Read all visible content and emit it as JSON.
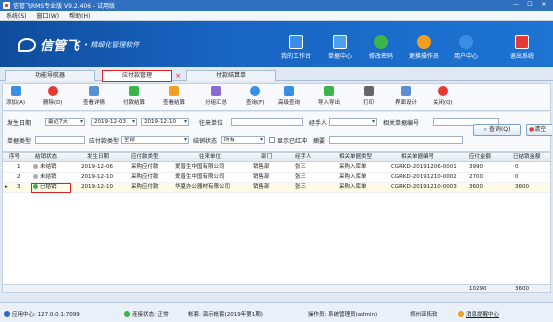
{
  "window": {
    "title": "信管飞RMS专业版 V9.2.406 - 试用版",
    "controls": [
      "—",
      "☐",
      "✕"
    ]
  },
  "menu": [
    "系统(S)",
    "窗口(W)",
    "帮助(H)"
  ],
  "banner": {
    "brand": "信管飞",
    "slogan": "• 精细化管理软件",
    "nav": [
      {
        "label": "我的工作台",
        "icon": "monitor-icon",
        "color": "#3a8ee6"
      },
      {
        "label": "单据中心",
        "icon": "documents-icon",
        "color": "#4aa3e8"
      },
      {
        "label": "修改密码",
        "icon": "key-icon",
        "color": "#3bb54a"
      },
      {
        "label": "更换操作员",
        "icon": "switch-user-icon",
        "color": "#f0a020"
      },
      {
        "label": "用户中心",
        "icon": "user-icon",
        "color": "#3a8ee6"
      },
      {
        "label": "退出系统",
        "icon": "power-icon",
        "color": "#e53935"
      }
    ]
  },
  "tabs": [
    {
      "label": "功能导航器",
      "active": false
    },
    {
      "label": "应付款管理",
      "active": true,
      "close": "×"
    },
    {
      "label": "付款结算单",
      "active": false
    }
  ],
  "toolbar": [
    {
      "label": "添加(A)",
      "icon": "add-icon",
      "color": "#3a8ee6"
    },
    {
      "label": "删除(D)",
      "icon": "delete-icon",
      "color": "#e53935"
    },
    {
      "label": "查看详情",
      "icon": "detail-icon",
      "color": "#5b8fd0"
    },
    {
      "label": "付款结算",
      "icon": "settle-icon",
      "color": "#3bb54a"
    },
    {
      "label": "查看结算",
      "icon": "view-settle-icon",
      "color": "#f0a020"
    },
    {
      "label": "分组汇总",
      "icon": "group-summary-icon",
      "color": "#8a6ad0"
    },
    {
      "label": "查询(F)",
      "icon": "query-icon",
      "color": "#3a8ee6"
    },
    {
      "label": "高级查询",
      "icon": "advanced-query-icon",
      "color": "#3a8ee6"
    },
    {
      "label": "导入导出",
      "icon": "import-export-icon",
      "color": "#3bb54a"
    },
    {
      "label": "打印",
      "icon": "print-icon",
      "color": "#666666"
    },
    {
      "label": "界面设计",
      "icon": "layout-design-icon",
      "color": "#5b8fd0"
    },
    {
      "label": "关闭(Q)",
      "icon": "close-icon",
      "color": "#e53935"
    }
  ],
  "filters": {
    "date_label": "发生日期",
    "date_range": "最近7天",
    "date_from": "2019-12-03",
    "date_to": "2019-12-10",
    "counterpart_label": "往来单位",
    "counterpart_value": "",
    "handler_label": "经手人",
    "handler_value": "",
    "related_doc_label": "相关单据编号",
    "related_doc_value": "",
    "doc_type_label": "单据类型",
    "doc_type_value": "",
    "ap_type_label": "应付款类型",
    "ap_type_value": "全部",
    "settle_status_label": "结销状态",
    "settle_status_value": "所有",
    "show_red_label": "显示已红冲",
    "remark_label": "摘要",
    "remark_value": "",
    "query_button": "查询(Q)",
    "reset_button": "清空"
  },
  "grid": {
    "columns": [
      "序号",
      "结销状态",
      "发生日期",
      "应付款类型",
      "往来单位",
      "部门",
      "经手人",
      "相关单据类型",
      "相关单据编号",
      "应付金额",
      "已结销金额"
    ],
    "rows": [
      {
        "no": "1",
        "status": "未结销",
        "status_color": "#aaaaaa",
        "date": "2019-12-06",
        "type": "采购应付款",
        "unit": "爱普生中国有限公司",
        "dept": "销售部",
        "handler": "张三",
        "doc_type": "采购入库单",
        "doc_no": "CGRKD-20191206-0001",
        "amount": "3990",
        "settled": "0"
      },
      {
        "no": "2",
        "status": "未结销",
        "status_color": "#aaaaaa",
        "date": "2019-12-10",
        "type": "采购应付款",
        "unit": "爱普生中国有限公司",
        "dept": "销售部",
        "handler": "张三",
        "doc_type": "采购入库单",
        "doc_no": "CGRKD-20191210-0002",
        "amount": "2700",
        "settled": "0"
      },
      {
        "no": "3",
        "status": "已结销",
        "status_color": "#3bb54a",
        "date": "2019-12-10",
        "type": "采购应付款",
        "unit": "华夏办公器材有限公司",
        "dept": "销售部",
        "handler": "张三",
        "doc_type": "采购入库单",
        "doc_no": "CGRKD-20191210-0003",
        "amount": "3600",
        "settled": "3600",
        "selected": true,
        "marker": "▸"
      }
    ],
    "totals": {
      "amount": "10290",
      "settled": "3600"
    }
  },
  "status": {
    "app_center": "应用中心: 127.0.0.1:7099",
    "connection": "连接状态: 正常",
    "account": "帐套: 演示帐套(2019年第1期)",
    "operator": "操作员: 系统管理员(admin)",
    "company": "郑州亚拓软",
    "message_center": "消息提醒中心"
  }
}
